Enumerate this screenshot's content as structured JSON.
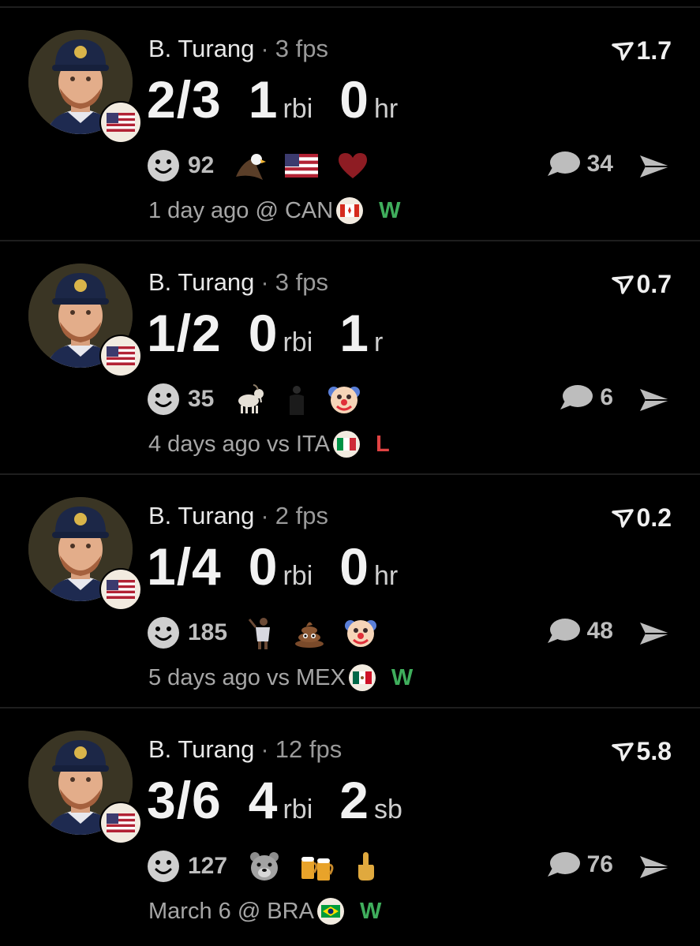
{
  "posts": [
    {
      "player_name": "B. Turang",
      "fps": "3 fps",
      "score": "1.7",
      "hits": "2/3",
      "stat2_value": "1",
      "stat2_unit": "rbi",
      "stat3_value": "0",
      "stat3_unit": "hr",
      "reaction_count": "92",
      "reaction_emojis": [
        "eagle-emoji",
        "us-flag-emoji",
        "heart-emoji"
      ],
      "comment_count": "34",
      "time_text": "1 day ago @ CAN",
      "opponent_flag": "canada-flag",
      "result": "W"
    },
    {
      "player_name": "B. Turang",
      "fps": "3 fps",
      "score": "0.7",
      "hits": "1/2",
      "stat2_value": "0",
      "stat2_unit": "rbi",
      "stat3_value": "1",
      "stat3_unit": "r",
      "reaction_count": "35",
      "reaction_emojis": [
        "goat-emoji",
        "person-emoji",
        "clown-emoji"
      ],
      "comment_count": "6",
      "time_text": "4 days ago vs ITA",
      "opponent_flag": "italy-flag",
      "result": "L"
    },
    {
      "player_name": "B. Turang",
      "fps": "2 fps",
      "score": "0.2",
      "hits": "1/4",
      "stat2_value": "0",
      "stat2_unit": "rbi",
      "stat3_value": "0",
      "stat3_unit": "hr",
      "reaction_count": "185",
      "reaction_emojis": [
        "player-sticker",
        "poop-emoji",
        "clown-emoji"
      ],
      "comment_count": "48",
      "time_text": "5 days ago vs MEX",
      "opponent_flag": "mexico-flag",
      "result": "W"
    },
    {
      "player_name": "B. Turang",
      "fps": "12 fps",
      "score": "5.8",
      "hits": "3/6",
      "stat2_value": "4",
      "stat2_unit": "rbi",
      "stat3_value": "2",
      "stat3_unit": "sb",
      "reaction_count": "127",
      "reaction_emojis": [
        "bear-emoji",
        "beer-mugs-emoji",
        "middle-finger-emoji"
      ],
      "comment_count": "76",
      "time_text": "March 6 @ BRA",
      "opponent_flag": "brazil-flag",
      "result": "W"
    }
  ],
  "colors": {
    "background": "#000000",
    "win": "#3fae5c",
    "loss": "#e04343",
    "muted": "#a6a6a6"
  }
}
